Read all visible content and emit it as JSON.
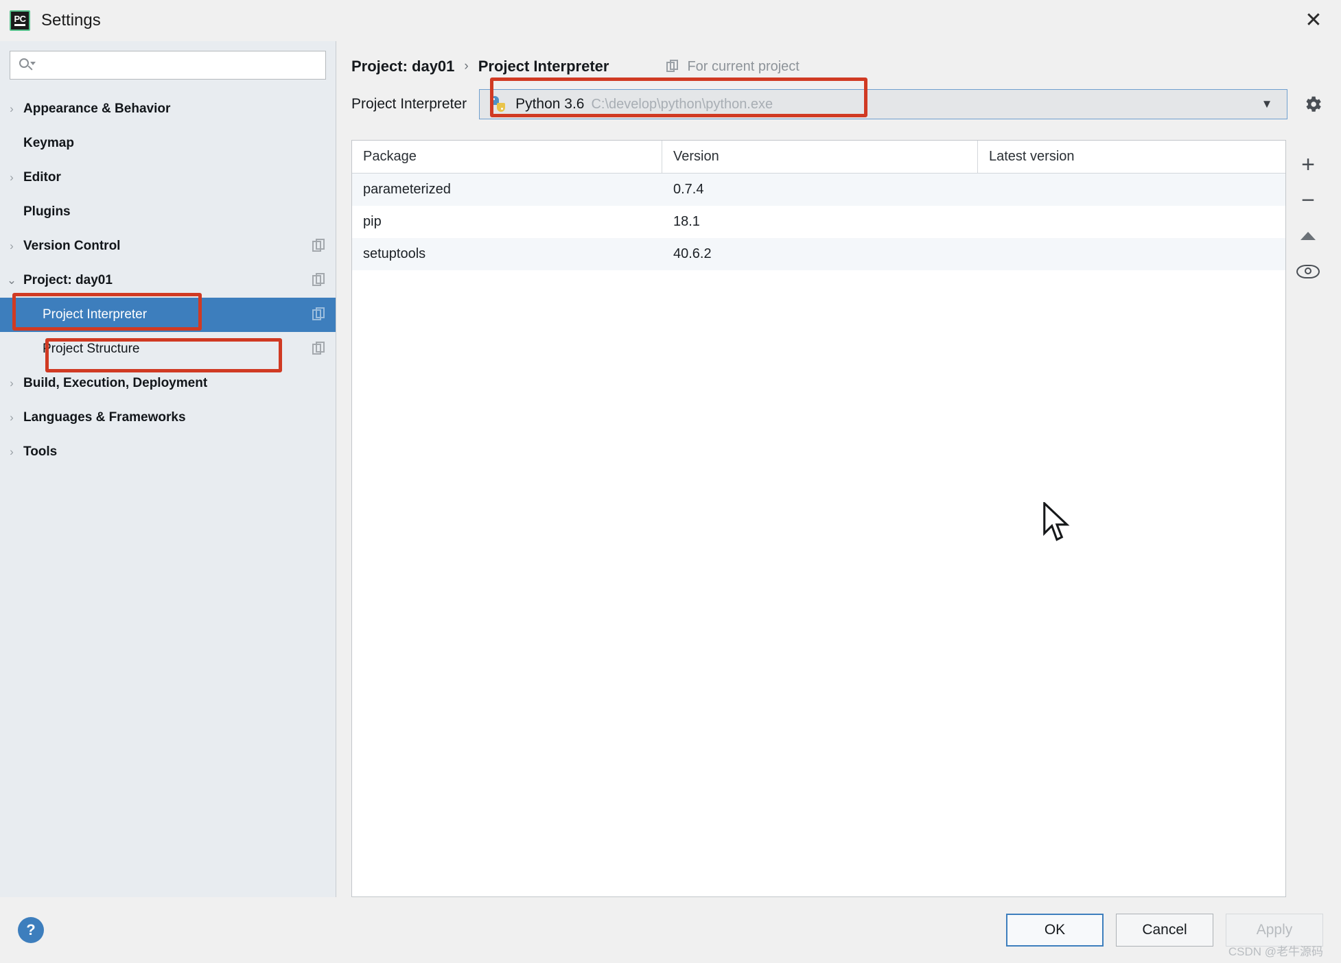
{
  "window": {
    "title": "Settings",
    "app_icon": "pycharm-logo-icon",
    "close_icon": "close-icon"
  },
  "search": {
    "value": "",
    "placeholder": "",
    "icon": "search-icon"
  },
  "sidebar": {
    "items": [
      {
        "label": "Appearance & Behavior",
        "arrow": "›",
        "bold": true,
        "child": false,
        "selected": false,
        "badge": false
      },
      {
        "label": "Keymap",
        "arrow": "",
        "bold": true,
        "child": false,
        "selected": false,
        "badge": false
      },
      {
        "label": "Editor",
        "arrow": "›",
        "bold": true,
        "child": false,
        "selected": false,
        "badge": false
      },
      {
        "label": "Plugins",
        "arrow": "",
        "bold": true,
        "child": false,
        "selected": false,
        "badge": false
      },
      {
        "label": "Version Control",
        "arrow": "›",
        "bold": true,
        "child": false,
        "selected": false,
        "badge": true
      },
      {
        "label": "Project: day01",
        "arrow": "⌄",
        "bold": true,
        "child": false,
        "selected": false,
        "badge": true
      },
      {
        "label": "Project Interpreter",
        "arrow": "",
        "bold": false,
        "child": true,
        "selected": true,
        "badge": true
      },
      {
        "label": "Project Structure",
        "arrow": "",
        "bold": false,
        "child": true,
        "selected": false,
        "badge": true
      },
      {
        "label": "Build, Execution, Deployment",
        "arrow": "›",
        "bold": true,
        "child": false,
        "selected": false,
        "badge": false
      },
      {
        "label": "Languages & Frameworks",
        "arrow": "›",
        "bold": true,
        "child": false,
        "selected": false,
        "badge": false
      },
      {
        "label": "Tools",
        "arrow": "›",
        "bold": true,
        "child": false,
        "selected": false,
        "badge": false
      }
    ]
  },
  "breadcrumb": {
    "parent": "Project: day01",
    "separator": "›",
    "current": "Project Interpreter",
    "scope_label": "For current project",
    "scope_icon": "copy-icon"
  },
  "interpreter": {
    "label": "Project Interpreter",
    "icon": "python-icon",
    "name": "Python 3.6",
    "path": "C:\\develop\\python\\python.exe",
    "dropdown_icon": "chevron-down-icon",
    "settings_icon": "gear-icon"
  },
  "packages": {
    "columns": [
      "Package",
      "Version",
      "Latest version"
    ],
    "rows": [
      {
        "package": "parameterized",
        "version": "0.7.4",
        "latest": ""
      },
      {
        "package": "pip",
        "version": "18.1",
        "latest": ""
      },
      {
        "package": "setuptools",
        "version": "40.6.2",
        "latest": ""
      }
    ],
    "toolbar": [
      {
        "icon": "add-package-icon",
        "glyph": "+"
      },
      {
        "icon": "remove-package-icon",
        "glyph": "−"
      },
      {
        "icon": "upgrade-package-icon",
        "glyph": ""
      },
      {
        "icon": "show-early-releases-icon",
        "glyph": ""
      }
    ]
  },
  "footer": {
    "help_icon": "help-icon",
    "help_glyph": "?",
    "ok": "OK",
    "cancel": "Cancel",
    "apply": "Apply"
  },
  "watermark": "CSDN @老牛源码",
  "colors": {
    "annotation": "#d03a23",
    "selection": "#3d7ebd",
    "accent": "#3c7ebf"
  }
}
